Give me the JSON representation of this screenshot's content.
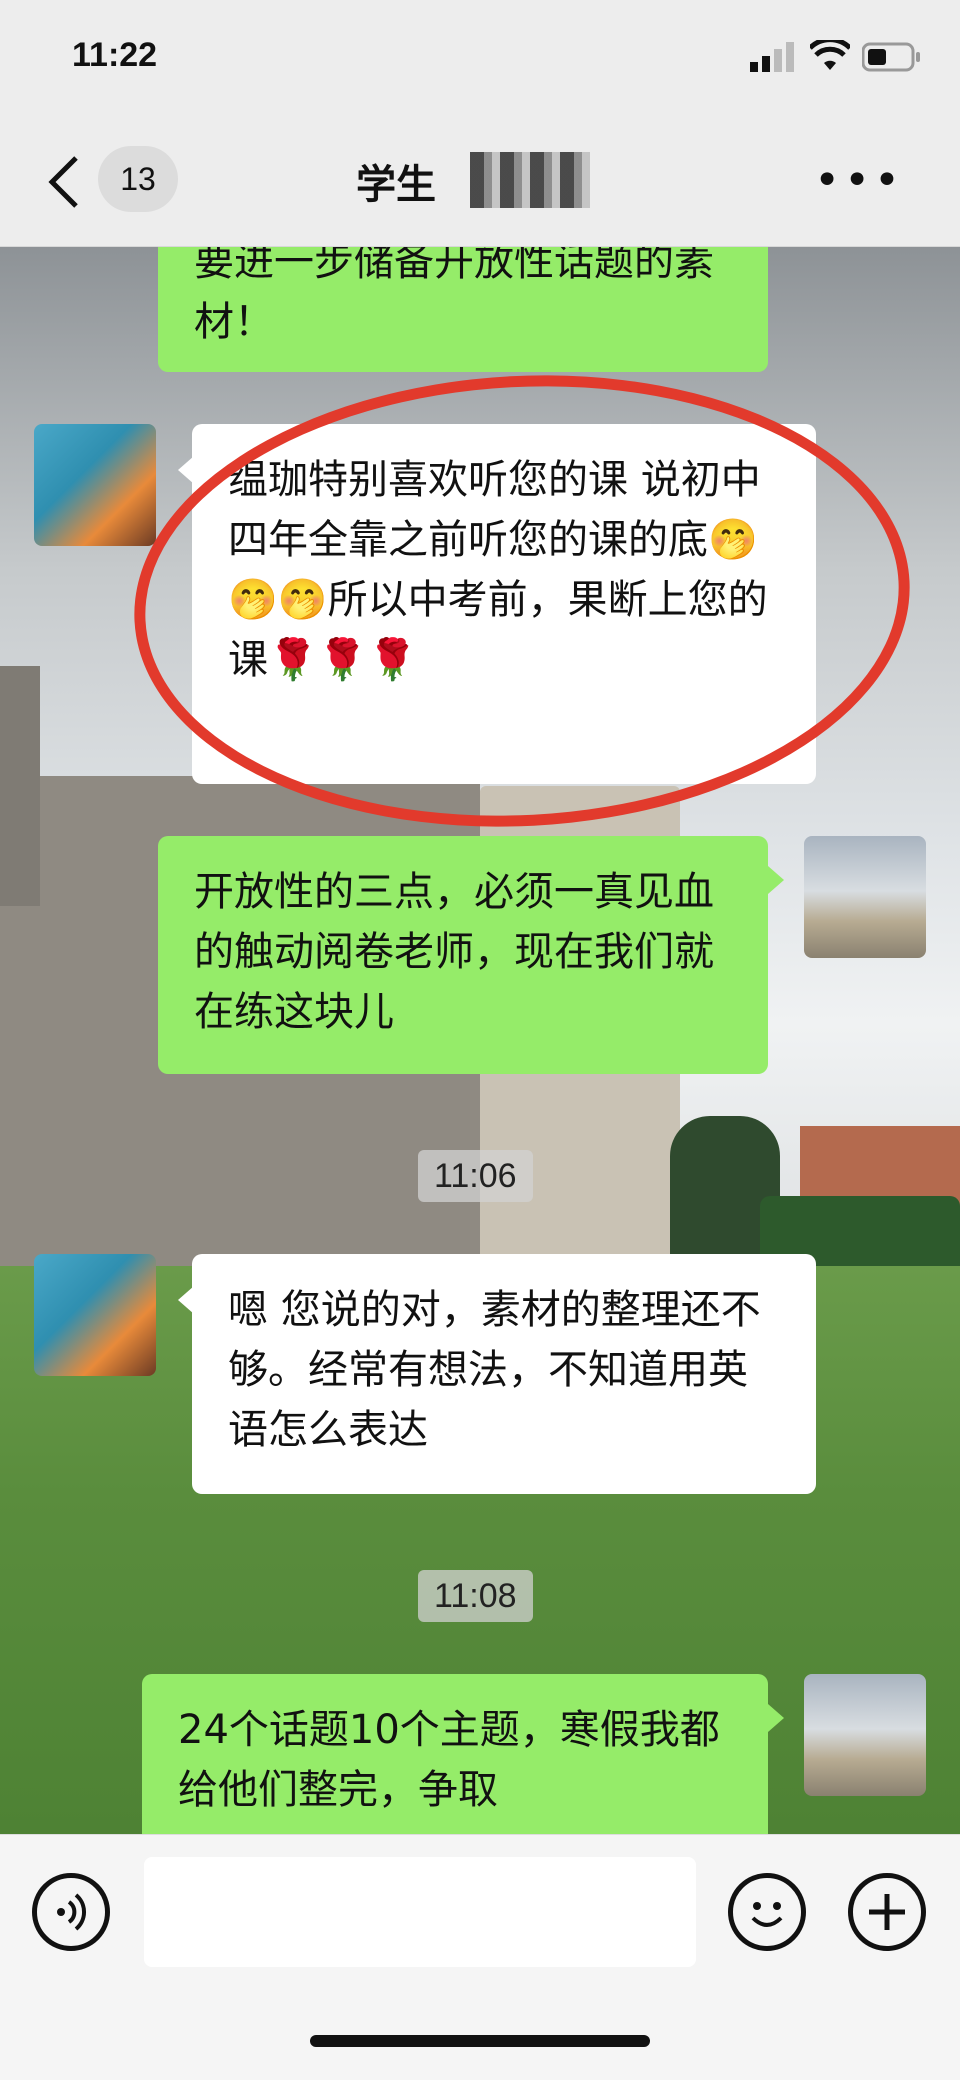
{
  "status_bar": {
    "time": "11:22"
  },
  "nav": {
    "unread_count": "13",
    "title": "学生"
  },
  "messages": [
    {
      "side": "right",
      "text": "要进一步储备开放性话题的素材！"
    },
    {
      "side": "left",
      "text": "缊珈特别喜欢听您的课 说初中四年全靠之前听您的课的底🤭🤭🤭所以中考前，果断上您的课🌹🌹🌹"
    },
    {
      "side": "right",
      "text": "开放性的三点，必须一真见血的触动阅卷老师，现在我们就在练这块儿"
    },
    {
      "side": "left",
      "text": "嗯 您说的对，素材的整理还不够。经常有想法，不知道用英语怎么表达"
    },
    {
      "side": "right",
      "text": "24个话题10个主题，寒假我都给他们整完，争取"
    }
  ],
  "timestamps": [
    "11:06",
    "11:08"
  ],
  "icons": {
    "back": "chevron-left-icon",
    "more": "more-dots-icon",
    "voice": "voice-icon",
    "emoji": "emoji-icon",
    "add": "plus-icon"
  },
  "colors": {
    "green_bubble": "#95ec69",
    "white_bubble": "#ffffff",
    "highlight_circle": "#e23a2c"
  }
}
